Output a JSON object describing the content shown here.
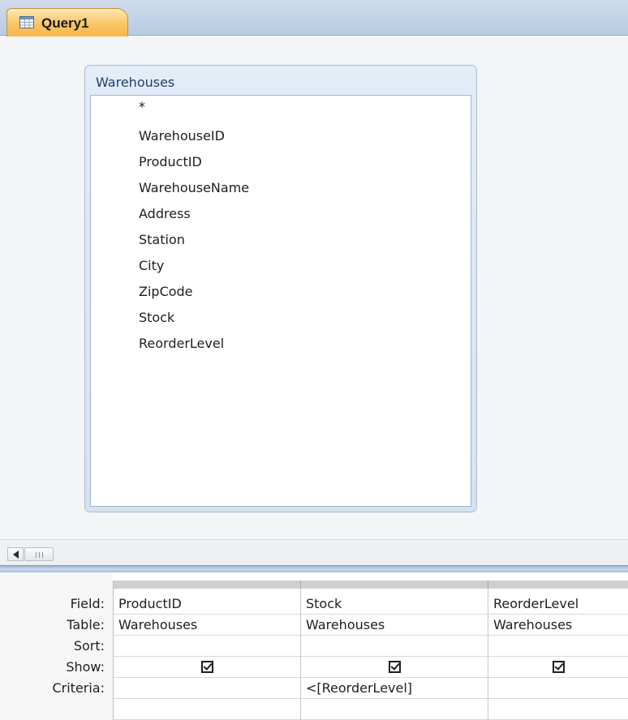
{
  "tab": {
    "title": "Query1",
    "icon": "query-design-icon"
  },
  "table_box": {
    "title": "Warehouses",
    "fields": [
      "*",
      "WarehouseID",
      "ProductID",
      "WarehouseName",
      "Address",
      "Station",
      "City",
      "ZipCode",
      "Stock",
      "ReorderLevel"
    ]
  },
  "grid": {
    "row_labels": {
      "field": "Field:",
      "table": "Table:",
      "sort": "Sort:",
      "show": "Show:",
      "criteria": "Criteria:"
    },
    "columns": [
      {
        "field": "ProductID",
        "table": "Warehouses",
        "sort": "",
        "show": true,
        "criteria": ""
      },
      {
        "field": "Stock",
        "table": "Warehouses",
        "sort": "",
        "show": true,
        "criteria": "<[ReorderLevel]"
      },
      {
        "field": "ReorderLevel",
        "table": "Warehouses",
        "sort": "",
        "show": true,
        "criteria": ""
      }
    ]
  },
  "colors": {
    "tab_active": "#f9c565",
    "tab_strip": "#c5d6ea",
    "table_header": "#dbe6f3"
  }
}
